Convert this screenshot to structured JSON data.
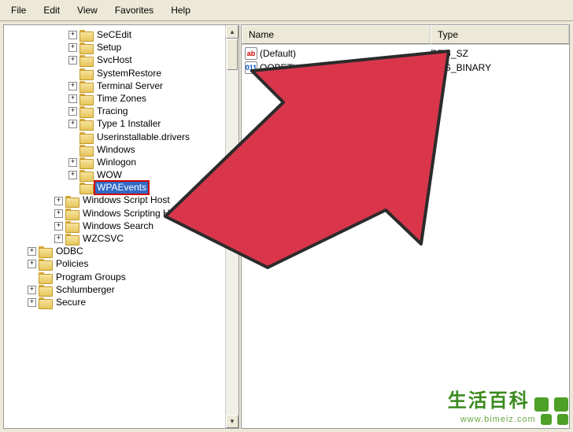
{
  "menu": {
    "file": "File",
    "edit": "Edit",
    "view": "View",
    "favorites": "Favorites",
    "help": "Help"
  },
  "tree": {
    "lvl2": [
      {
        "label": "SeCEdit",
        "exp": "+"
      },
      {
        "label": "Setup",
        "exp": "+"
      },
      {
        "label": "SvcHost",
        "exp": "+"
      },
      {
        "label": "SystemRestore",
        "exp": ""
      },
      {
        "label": "Terminal Server",
        "exp": "+"
      },
      {
        "label": "Time Zones",
        "exp": "+"
      },
      {
        "label": "Tracing",
        "exp": "+"
      },
      {
        "label": "Type 1 Installer",
        "exp": "+"
      },
      {
        "label": "Userinstallable.drivers",
        "exp": ""
      },
      {
        "label": "Windows",
        "exp": ""
      },
      {
        "label": "Winlogon",
        "exp": "+"
      },
      {
        "label": "WOW",
        "exp": "+"
      },
      {
        "label": "WPAEvents",
        "exp": "",
        "selected": true
      }
    ],
    "lvl1": [
      {
        "label": "Windows Script Host",
        "exp": "+"
      },
      {
        "label": "Windows Scripting Host",
        "exp": "+"
      },
      {
        "label": "Windows Search",
        "exp": "+"
      },
      {
        "label": "WZCSVC",
        "exp": "+"
      }
    ],
    "lvl0a": [
      {
        "label": "ODBC",
        "exp": "+"
      },
      {
        "label": "Policies",
        "exp": "+"
      },
      {
        "label": "Program Groups",
        "exp": ""
      },
      {
        "label": "Schlumberger",
        "exp": "+"
      },
      {
        "label": "Secure",
        "exp": "+"
      }
    ]
  },
  "columns": {
    "name": "Name",
    "type": "Type"
  },
  "values": [
    {
      "name": "(Default)",
      "type": "REG_SZ",
      "icon": "ab"
    },
    {
      "name": "OOBETime",
      "type": "REG_BINARY",
      "icon": "bin"
    }
  ],
  "watermark": {
    "text": "生活百科",
    "url": "www.bimeiz.com"
  }
}
